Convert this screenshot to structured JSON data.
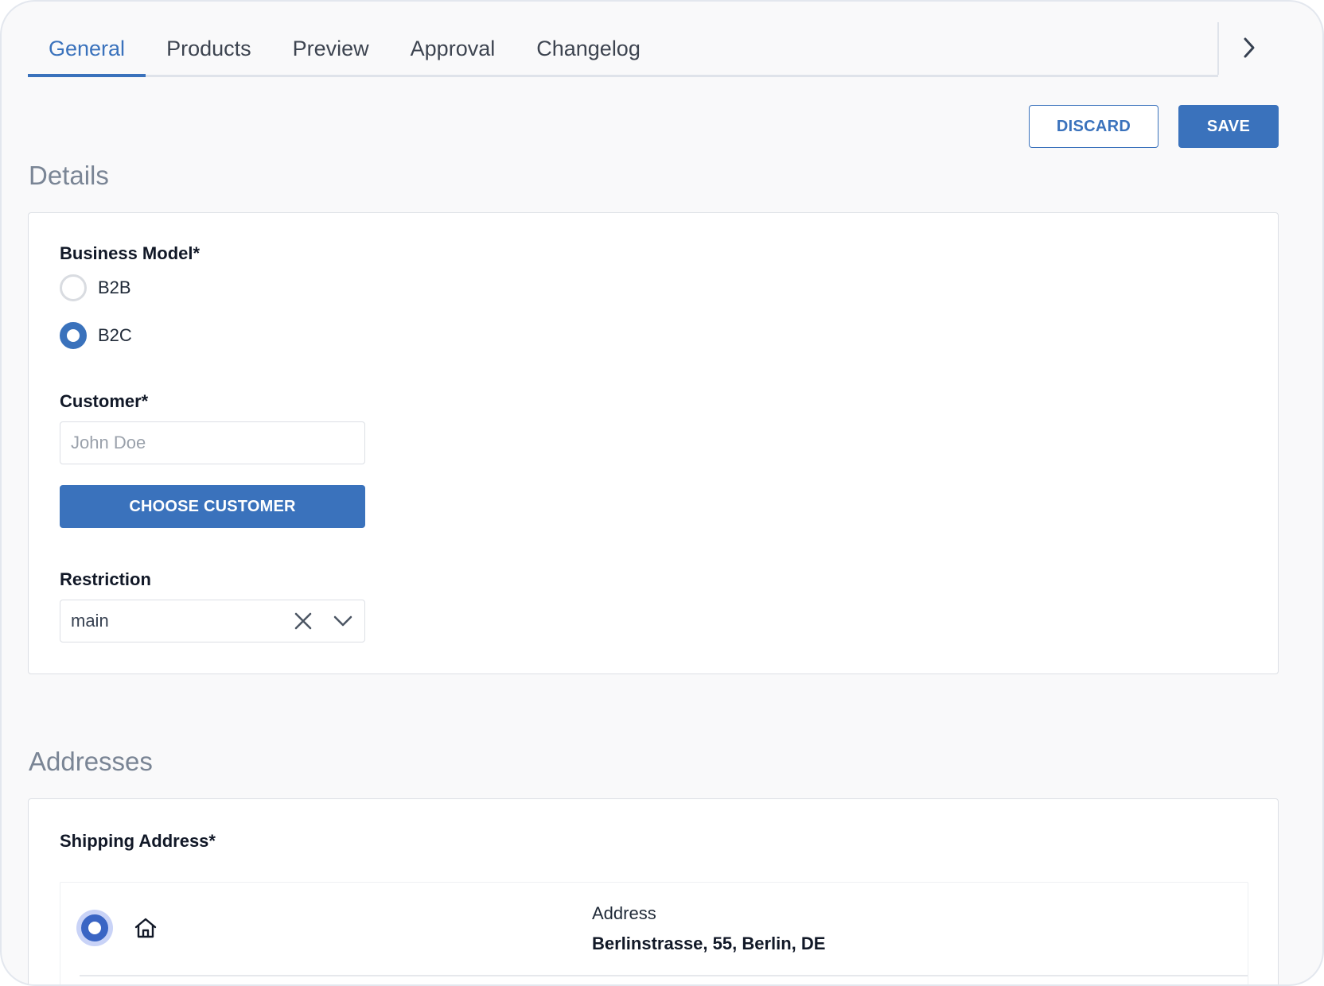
{
  "tabs": [
    {
      "label": "General",
      "active": true
    },
    {
      "label": "Products"
    },
    {
      "label": "Preview"
    },
    {
      "label": "Approval"
    },
    {
      "label": "Changelog"
    }
  ],
  "actions": {
    "discard_label": "DISCARD",
    "save_label": "SAVE"
  },
  "details": {
    "title": "Details",
    "business_model": {
      "label": "Business Model*",
      "options": [
        {
          "label": "B2B",
          "checked": false
        },
        {
          "label": "B2C",
          "checked": true
        }
      ]
    },
    "customer": {
      "label": "Customer*",
      "placeholder": "John Doe",
      "choose_label": "CHOOSE CUSTOMER"
    },
    "restriction": {
      "label": "Restriction",
      "value": "main"
    }
  },
  "addresses": {
    "title": "Addresses",
    "shipping": {
      "label": "Shipping Address*",
      "caption": "Address",
      "value": "Berlinstrasse, 55, Berlin, DE",
      "icon": "home-icon"
    }
  },
  "colors": {
    "accent": "#3a72bc",
    "muted_heading": "#7a8595"
  }
}
